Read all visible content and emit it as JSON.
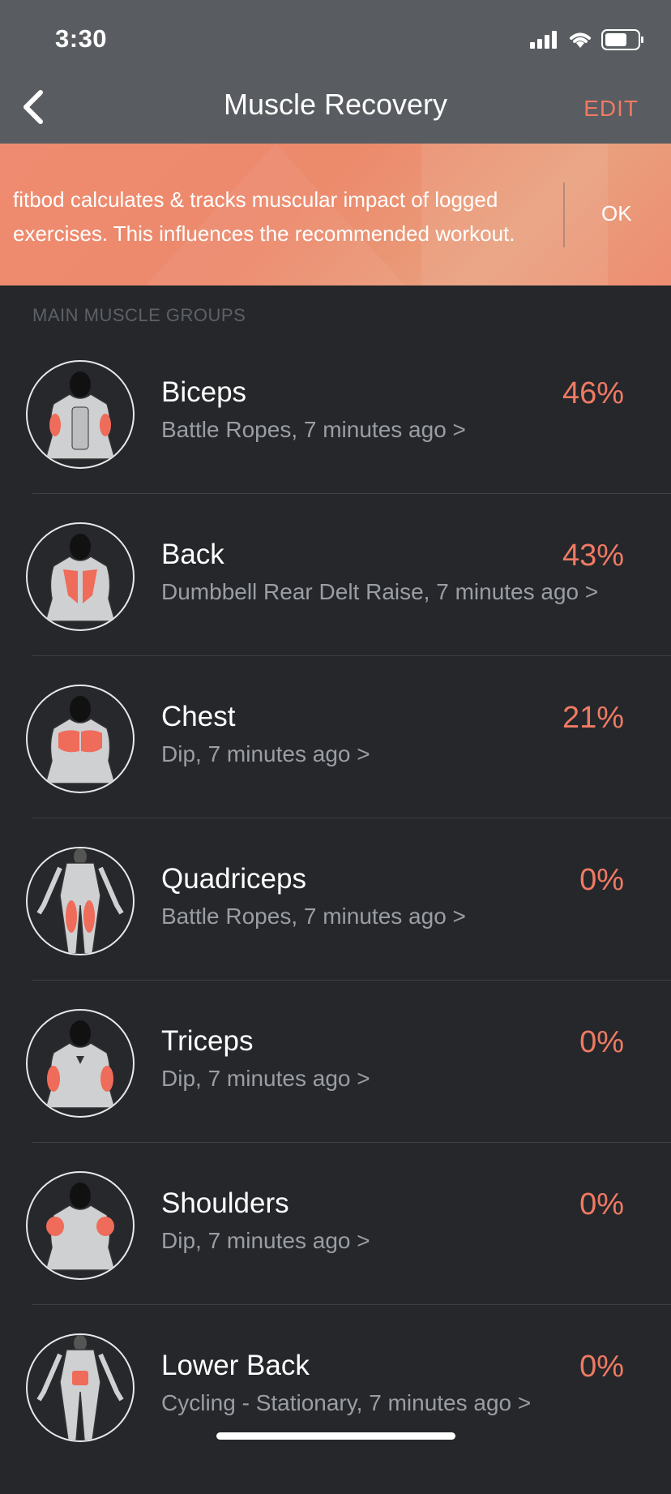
{
  "status_bar": {
    "time": "3:30"
  },
  "nav": {
    "title": "Muscle Recovery",
    "edit_label": "EDIT"
  },
  "banner": {
    "text": "fitbod calculates & tracks muscular impact of logged exercises. This influences the recommended workout.",
    "ok_label": "OK"
  },
  "section": {
    "label": "MAIN MUSCLE GROUPS"
  },
  "muscles": [
    {
      "name": "Biceps",
      "detail": "Battle Ropes, 7 minutes ago >",
      "percent": "46%",
      "icon": "biceps-figure"
    },
    {
      "name": "Back",
      "detail": "Dumbbell Rear Delt Raise, 7 minutes ago >",
      "percent": "43%",
      "icon": "back-figure"
    },
    {
      "name": "Chest",
      "detail": "Dip, 7 minutes ago >",
      "percent": "21%",
      "icon": "chest-figure"
    },
    {
      "name": "Quadriceps",
      "detail": "Battle Ropes, 7 minutes ago >",
      "percent": "0%",
      "icon": "quadriceps-figure"
    },
    {
      "name": "Triceps",
      "detail": "Dip, 7 minutes ago >",
      "percent": "0%",
      "icon": "triceps-figure"
    },
    {
      "name": "Shoulders",
      "detail": "Dip, 7 minutes ago >",
      "percent": "0%",
      "icon": "shoulders-figure"
    },
    {
      "name": "Lower Back",
      "detail": "Cycling - Stationary, 7 minutes ago >",
      "percent": "0%",
      "icon": "lower-back-figure"
    }
  ],
  "colors": {
    "accent": "#ef7a63",
    "header_bg": "#595d61",
    "page_bg": "#25272b",
    "muscle_highlight": "#ef6b5a"
  }
}
